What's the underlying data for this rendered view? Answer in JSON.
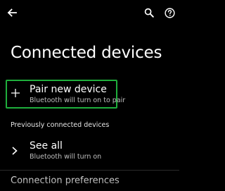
{
  "header": {
    "back_icon": "arrow-back-icon",
    "search_icon": "search-icon",
    "help_icon": "help-icon"
  },
  "page": {
    "title": "Connected devices"
  },
  "pair_item": {
    "icon": "plus-icon",
    "title": "Pair new device",
    "subtitle": "Bluetooth will turn on to pair",
    "highlight_color": "#1fae3c"
  },
  "section": {
    "header": "Previously connected devices"
  },
  "see_all": {
    "icon": "chevron-right-icon",
    "title": "See all",
    "subtitle": "Bluetooth will turn on"
  },
  "connection_preferences": {
    "label": "Connection preferences"
  }
}
